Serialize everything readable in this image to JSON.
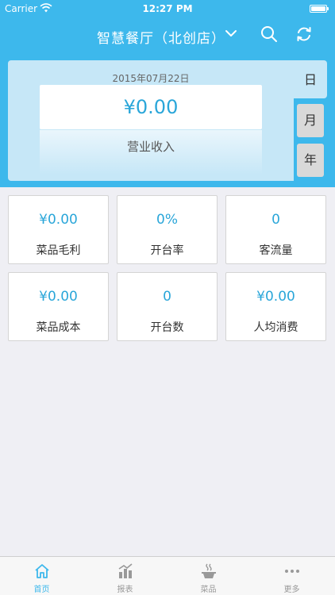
{
  "status_bar": {
    "carrier": "Carrier",
    "time": "12:27 PM",
    "battery_level": 1.0
  },
  "nav": {
    "title": "智慧餐厅（北创店）",
    "icons": [
      "chevron-down-icon",
      "search-icon",
      "refresh-icon"
    ]
  },
  "summary": {
    "date": "2015年07月22日",
    "amount": "¥0.00",
    "label": "营业收入"
  },
  "period_tabs": [
    {
      "label": "日",
      "selected": true
    },
    {
      "label": "月",
      "selected": false
    },
    {
      "label": "年",
      "selected": false
    }
  ],
  "stats": [
    {
      "value": "¥0.00",
      "label": "菜品毛利"
    },
    {
      "value": "0%",
      "label": "开台率"
    },
    {
      "value": "0",
      "label": "客流量"
    },
    {
      "value": "¥0.00",
      "label": "菜品成本"
    },
    {
      "value": "0",
      "label": "开台数"
    },
    {
      "value": "¥0.00",
      "label": "人均消费"
    }
  ],
  "tab_bar": [
    {
      "label": "首页",
      "icon": "home-icon",
      "active": true
    },
    {
      "label": "报表",
      "icon": "report-chart-icon",
      "active": false
    },
    {
      "label": "菜品",
      "icon": "dish-icon",
      "active": false
    },
    {
      "label": "更多",
      "icon": "more-dots-icon",
      "active": false
    }
  ],
  "colors": {
    "accent": "#3db8ec",
    "value_text": "#2aa6d9",
    "summary_bg": "#c6e7f7",
    "page_bg": "#efeff4",
    "tab_inactive": "#999999"
  }
}
